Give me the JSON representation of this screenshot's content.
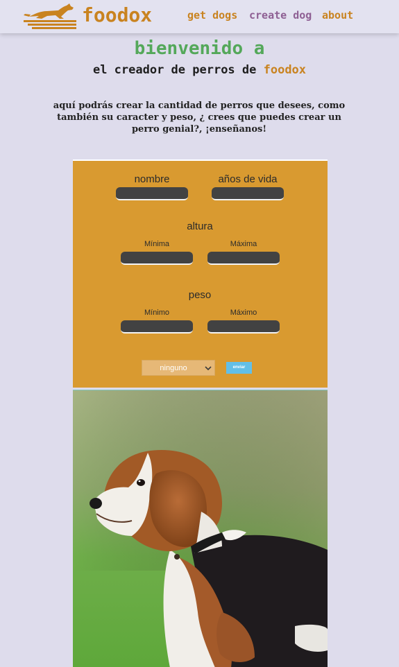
{
  "nav": {
    "logo_text": "foodox",
    "links": [
      "get dogs",
      "create dog",
      "about"
    ]
  },
  "hero": {
    "title": "bienvenido a",
    "subtitle_prefix": "el creador de perros de ",
    "subtitle_brand": "foodox",
    "description": "aquí podrás crear la cantidad de perros que desees, como también su caracter y peso, ¿ crees que puedes crear un perro genial?, ¡enseñanos!"
  },
  "form": {
    "name_label": "nombre",
    "life_label": "años de vida",
    "height_label": "altura",
    "height_min_label": "Mínima",
    "height_max_label": "Máxima",
    "weight_label": "peso",
    "weight_min_label": "Mínimo",
    "weight_max_label": "Máximo",
    "temperament_selected": "ninguno",
    "submit_label": "enviar"
  },
  "colors": {
    "background": "#dedcec",
    "brand_orange": "#c98320",
    "nav_purple": "#8e5f93",
    "title_green": "#54a85a",
    "form_bg": "#d99a30",
    "input_bg": "#424242",
    "button_blue": "#62bfe8"
  },
  "icons": {
    "logo": "running-dog-logo-icon",
    "select_caret": "chevron-down-icon"
  }
}
